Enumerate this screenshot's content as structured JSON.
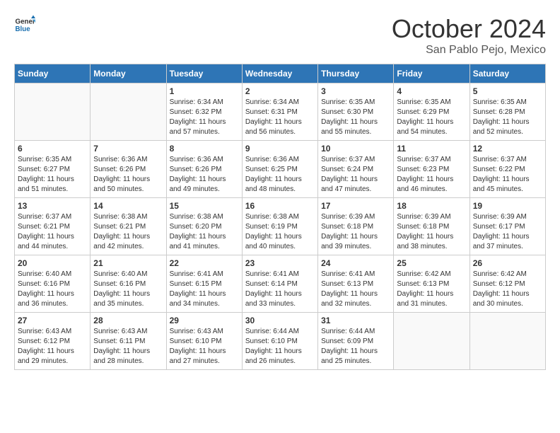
{
  "header": {
    "logo_general": "General",
    "logo_blue": "Blue",
    "month_title": "October 2024",
    "location": "San Pablo Pejo, Mexico"
  },
  "weekdays": [
    "Sunday",
    "Monday",
    "Tuesday",
    "Wednesday",
    "Thursday",
    "Friday",
    "Saturday"
  ],
  "weeks": [
    [
      {
        "day": "",
        "sunrise": "",
        "sunset": "",
        "daylight": ""
      },
      {
        "day": "",
        "sunrise": "",
        "sunset": "",
        "daylight": ""
      },
      {
        "day": "1",
        "sunrise": "Sunrise: 6:34 AM",
        "sunset": "Sunset: 6:32 PM",
        "daylight": "Daylight: 11 hours and 57 minutes."
      },
      {
        "day": "2",
        "sunrise": "Sunrise: 6:34 AM",
        "sunset": "Sunset: 6:31 PM",
        "daylight": "Daylight: 11 hours and 56 minutes."
      },
      {
        "day": "3",
        "sunrise": "Sunrise: 6:35 AM",
        "sunset": "Sunset: 6:30 PM",
        "daylight": "Daylight: 11 hours and 55 minutes."
      },
      {
        "day": "4",
        "sunrise": "Sunrise: 6:35 AM",
        "sunset": "Sunset: 6:29 PM",
        "daylight": "Daylight: 11 hours and 54 minutes."
      },
      {
        "day": "5",
        "sunrise": "Sunrise: 6:35 AM",
        "sunset": "Sunset: 6:28 PM",
        "daylight": "Daylight: 11 hours and 52 minutes."
      }
    ],
    [
      {
        "day": "6",
        "sunrise": "Sunrise: 6:35 AM",
        "sunset": "Sunset: 6:27 PM",
        "daylight": "Daylight: 11 hours and 51 minutes."
      },
      {
        "day": "7",
        "sunrise": "Sunrise: 6:36 AM",
        "sunset": "Sunset: 6:26 PM",
        "daylight": "Daylight: 11 hours and 50 minutes."
      },
      {
        "day": "8",
        "sunrise": "Sunrise: 6:36 AM",
        "sunset": "Sunset: 6:26 PM",
        "daylight": "Daylight: 11 hours and 49 minutes."
      },
      {
        "day": "9",
        "sunrise": "Sunrise: 6:36 AM",
        "sunset": "Sunset: 6:25 PM",
        "daylight": "Daylight: 11 hours and 48 minutes."
      },
      {
        "day": "10",
        "sunrise": "Sunrise: 6:37 AM",
        "sunset": "Sunset: 6:24 PM",
        "daylight": "Daylight: 11 hours and 47 minutes."
      },
      {
        "day": "11",
        "sunrise": "Sunrise: 6:37 AM",
        "sunset": "Sunset: 6:23 PM",
        "daylight": "Daylight: 11 hours and 46 minutes."
      },
      {
        "day": "12",
        "sunrise": "Sunrise: 6:37 AM",
        "sunset": "Sunset: 6:22 PM",
        "daylight": "Daylight: 11 hours and 45 minutes."
      }
    ],
    [
      {
        "day": "13",
        "sunrise": "Sunrise: 6:37 AM",
        "sunset": "Sunset: 6:21 PM",
        "daylight": "Daylight: 11 hours and 44 minutes."
      },
      {
        "day": "14",
        "sunrise": "Sunrise: 6:38 AM",
        "sunset": "Sunset: 6:21 PM",
        "daylight": "Daylight: 11 hours and 42 minutes."
      },
      {
        "day": "15",
        "sunrise": "Sunrise: 6:38 AM",
        "sunset": "Sunset: 6:20 PM",
        "daylight": "Daylight: 11 hours and 41 minutes."
      },
      {
        "day": "16",
        "sunrise": "Sunrise: 6:38 AM",
        "sunset": "Sunset: 6:19 PM",
        "daylight": "Daylight: 11 hours and 40 minutes."
      },
      {
        "day": "17",
        "sunrise": "Sunrise: 6:39 AM",
        "sunset": "Sunset: 6:18 PM",
        "daylight": "Daylight: 11 hours and 39 minutes."
      },
      {
        "day": "18",
        "sunrise": "Sunrise: 6:39 AM",
        "sunset": "Sunset: 6:18 PM",
        "daylight": "Daylight: 11 hours and 38 minutes."
      },
      {
        "day": "19",
        "sunrise": "Sunrise: 6:39 AM",
        "sunset": "Sunset: 6:17 PM",
        "daylight": "Daylight: 11 hours and 37 minutes."
      }
    ],
    [
      {
        "day": "20",
        "sunrise": "Sunrise: 6:40 AM",
        "sunset": "Sunset: 6:16 PM",
        "daylight": "Daylight: 11 hours and 36 minutes."
      },
      {
        "day": "21",
        "sunrise": "Sunrise: 6:40 AM",
        "sunset": "Sunset: 6:16 PM",
        "daylight": "Daylight: 11 hours and 35 minutes."
      },
      {
        "day": "22",
        "sunrise": "Sunrise: 6:41 AM",
        "sunset": "Sunset: 6:15 PM",
        "daylight": "Daylight: 11 hours and 34 minutes."
      },
      {
        "day": "23",
        "sunrise": "Sunrise: 6:41 AM",
        "sunset": "Sunset: 6:14 PM",
        "daylight": "Daylight: 11 hours and 33 minutes."
      },
      {
        "day": "24",
        "sunrise": "Sunrise: 6:41 AM",
        "sunset": "Sunset: 6:13 PM",
        "daylight": "Daylight: 11 hours and 32 minutes."
      },
      {
        "day": "25",
        "sunrise": "Sunrise: 6:42 AM",
        "sunset": "Sunset: 6:13 PM",
        "daylight": "Daylight: 11 hours and 31 minutes."
      },
      {
        "day": "26",
        "sunrise": "Sunrise: 6:42 AM",
        "sunset": "Sunset: 6:12 PM",
        "daylight": "Daylight: 11 hours and 30 minutes."
      }
    ],
    [
      {
        "day": "27",
        "sunrise": "Sunrise: 6:43 AM",
        "sunset": "Sunset: 6:12 PM",
        "daylight": "Daylight: 11 hours and 29 minutes."
      },
      {
        "day": "28",
        "sunrise": "Sunrise: 6:43 AM",
        "sunset": "Sunset: 6:11 PM",
        "daylight": "Daylight: 11 hours and 28 minutes."
      },
      {
        "day": "29",
        "sunrise": "Sunrise: 6:43 AM",
        "sunset": "Sunset: 6:10 PM",
        "daylight": "Daylight: 11 hours and 27 minutes."
      },
      {
        "day": "30",
        "sunrise": "Sunrise: 6:44 AM",
        "sunset": "Sunset: 6:10 PM",
        "daylight": "Daylight: 11 hours and 26 minutes."
      },
      {
        "day": "31",
        "sunrise": "Sunrise: 6:44 AM",
        "sunset": "Sunset: 6:09 PM",
        "daylight": "Daylight: 11 hours and 25 minutes."
      },
      {
        "day": "",
        "sunrise": "",
        "sunset": "",
        "daylight": ""
      },
      {
        "day": "",
        "sunrise": "",
        "sunset": "",
        "daylight": ""
      }
    ]
  ]
}
